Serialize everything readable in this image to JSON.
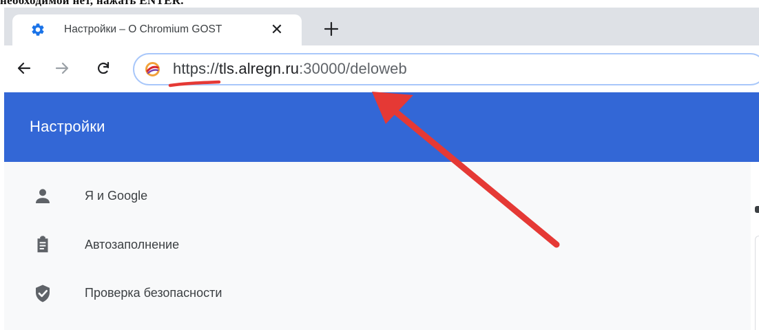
{
  "document": {
    "caption": "необходимой нет, нажать ENTER."
  },
  "browser": {
    "tab": {
      "title": "Настройки – О Chromium GOST",
      "favicon": "gear-icon",
      "close_glyph": "✕"
    },
    "new_tab_icon": "plus-icon",
    "nav": {
      "back_icon": "arrow-left-icon",
      "forward_icon": "arrow-right-icon",
      "reload_icon": "reload-icon"
    },
    "omnibox": {
      "site_icon": "chromium-gost-icon",
      "url_scheme": "https://",
      "url_host": "tls.alregn.ru",
      "url_rest": ":30000/deloweb"
    }
  },
  "settings": {
    "header_title": "Настройки",
    "header_color": "#3367d6",
    "menu": [
      {
        "label": "Я и Google",
        "icon": "person-icon"
      },
      {
        "label": "Автозаполнение",
        "icon": "clipboard-icon"
      },
      {
        "label": "Проверка безопасности",
        "icon": "shield-check-icon"
      }
    ]
  },
  "annotation": {
    "color": "#e53935",
    "underline": "https",
    "arrow_target": "address-bar"
  }
}
